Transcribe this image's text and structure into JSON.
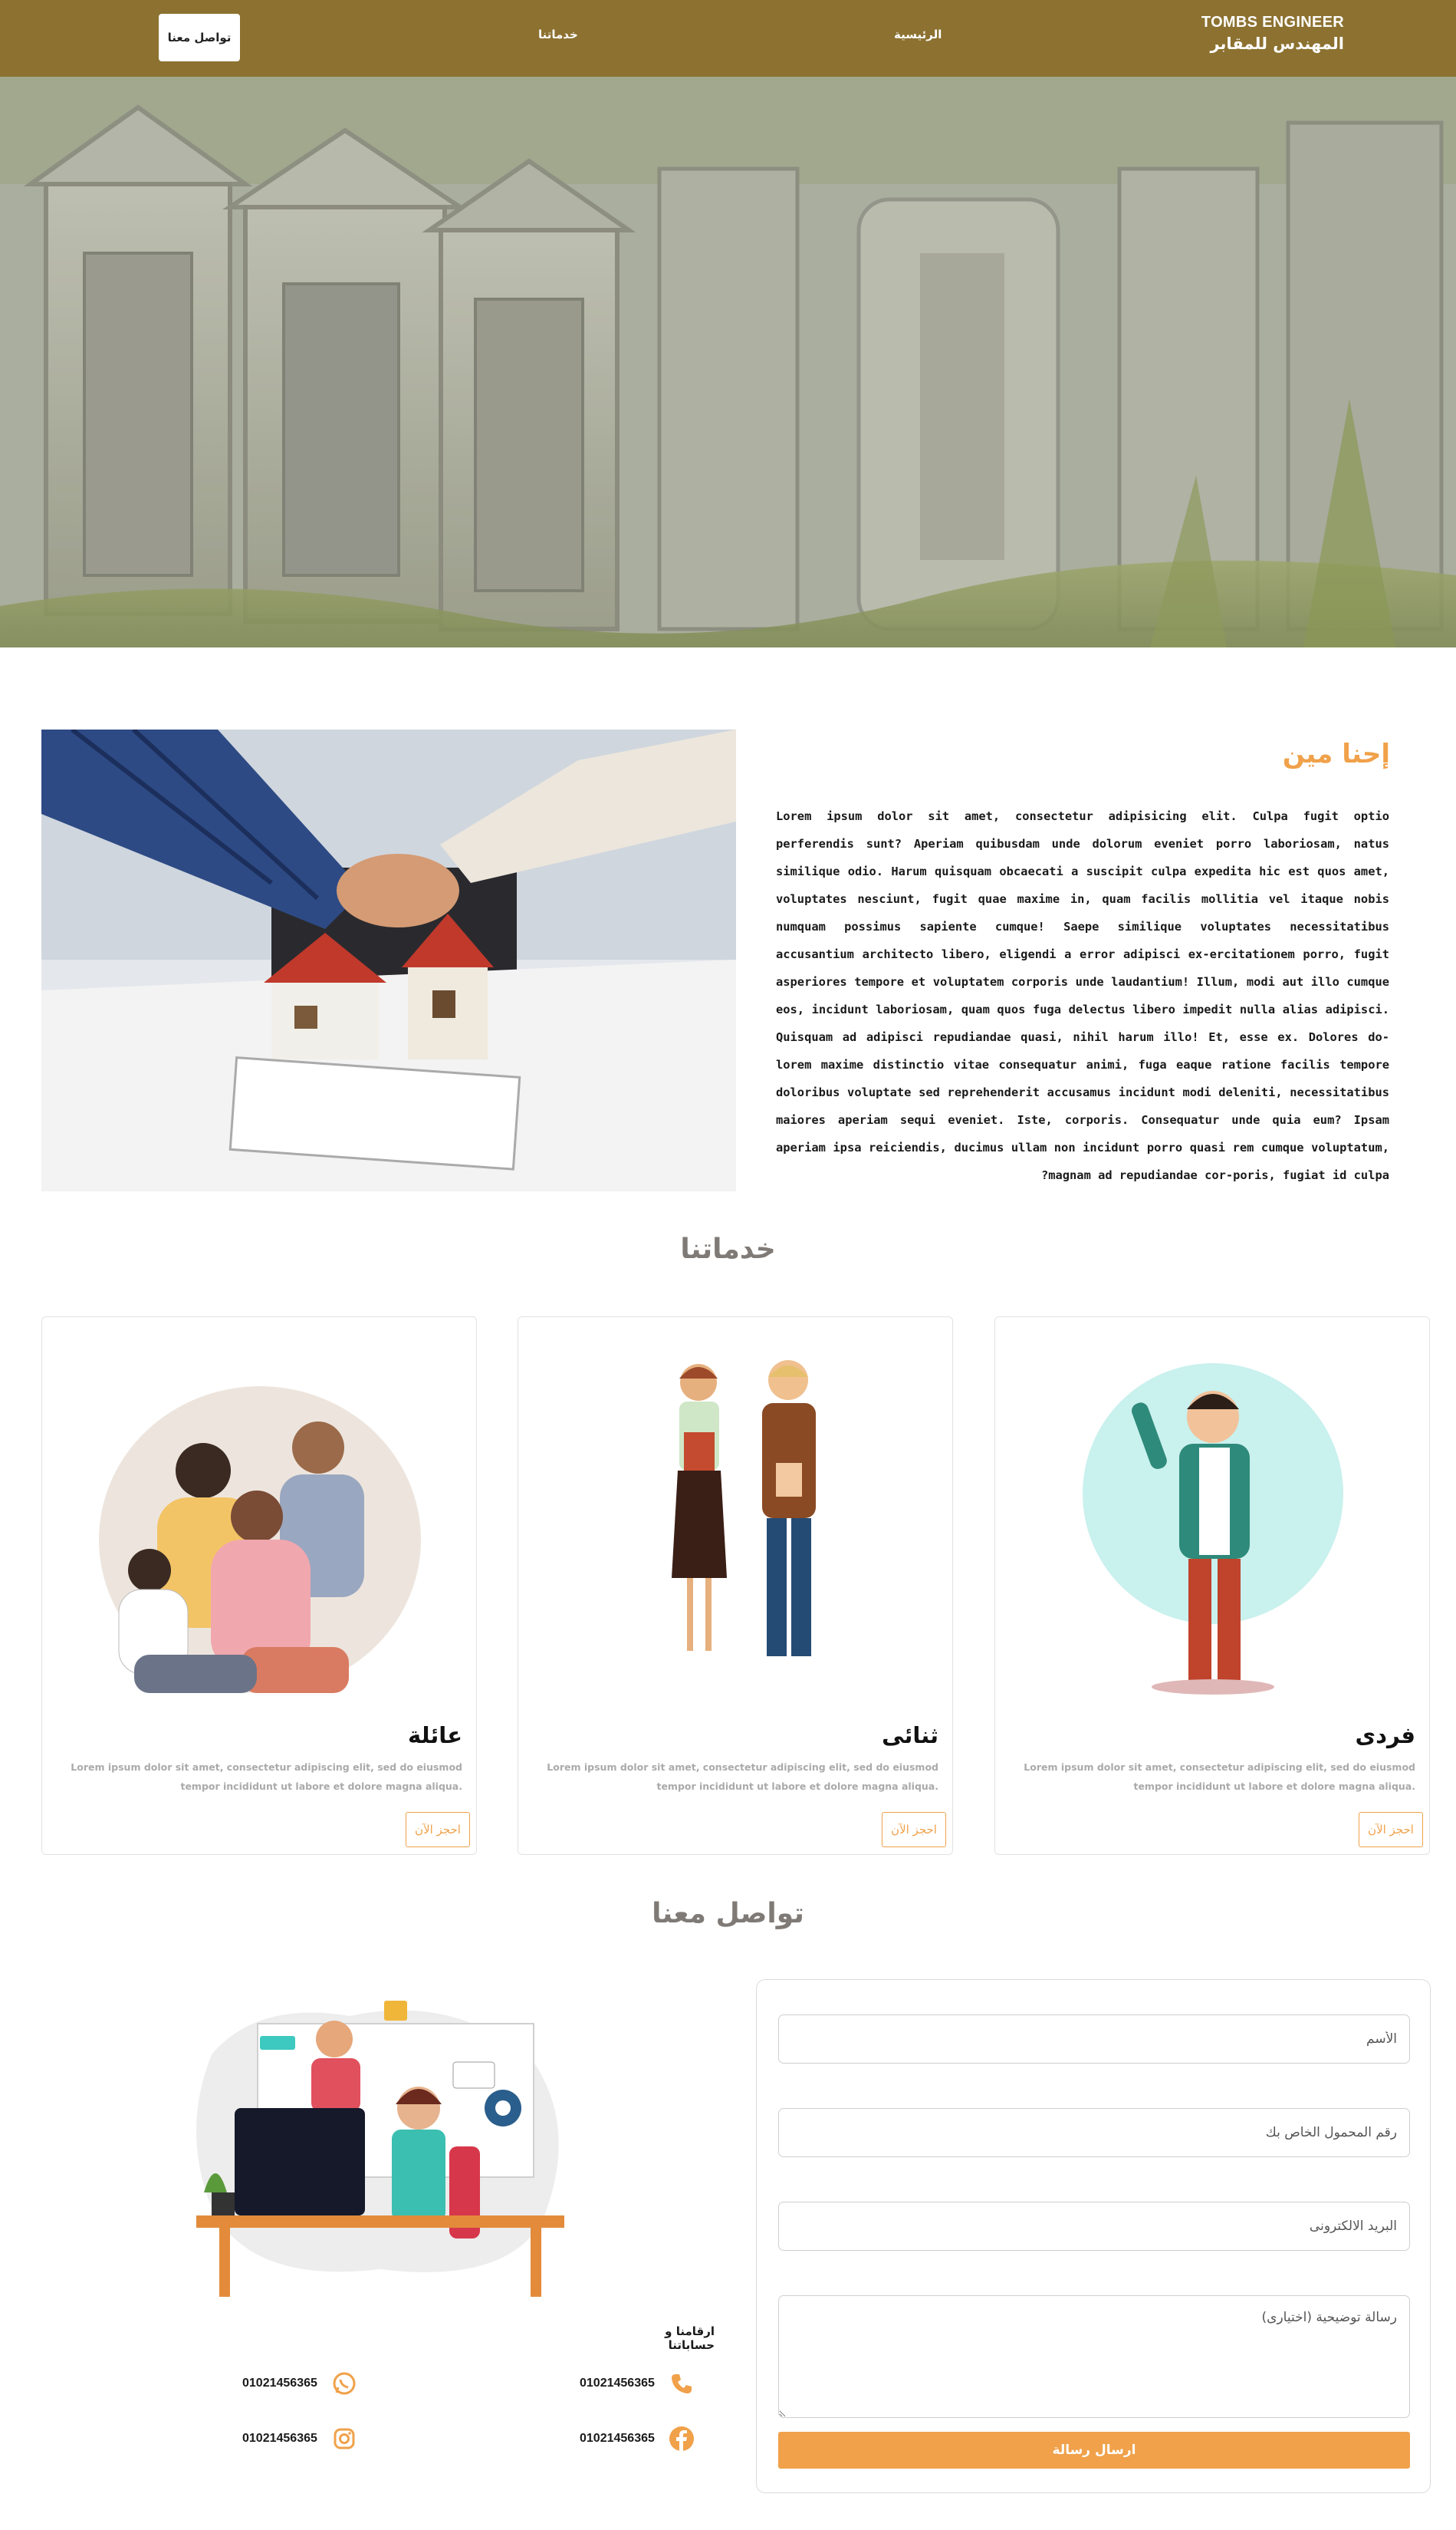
{
  "navbar": {
    "contact_button": "تواصل معنا",
    "services_link": "خدماتنا",
    "home_link": "الرئيسية",
    "brand_en": "TOMBS ENGINEER",
    "brand_ar": "المهندس للمقابر",
    "bg_color": "#8c7130"
  },
  "hero": {
    "slide_count": 4,
    "active_slide": 4
  },
  "about": {
    "title": "إحنا مين",
    "text": "Lorem ipsum dolor sit amet, consectetur adipisicing elit. Culpa fugit optio perferendis sunt? Aperiam quibusdam unde dolorum eveniet porro laboriosam, natus similique odio. Harum quisquam obcaecati a suscipit culpa expedita hic est quos amet, voluptates nesciunt, fugit quae maxime in, quam facilis mollitia vel itaque nobis numquam possimus sapiente cumque! Saepe similique voluptates necessitatibus accusantium architecto libero, eligendi a error adipisci ex-ercitationem porro, fugit asperiores tempore et voluptatem corporis unde laudantium! Illum, modi aut illo cumque eos, incidunt laboriosam, quam quos fuga delectus libero impedit nulla alias adipisci. Quisquam ad adipisci repudiandae quasi, nihil harum illo! Et, esse ex. Dolores do-lorem maxime distinctio vitae consequatur animi, fuga eaque ratione facilis tempore doloribus voluptate sed reprehenderit accusamus incidunt modi deleniti, necessitatibus maiores aperiam sequi eveniet. Iste, corporis. Consequatur unde quia eum? Ipsam aperiam ipsa reiciendis, ducimus ullam non incidunt porro quasi rem cumque voluptatum, magnam ad repudiandae cor-poris, fugiat id culpa?"
  },
  "services": {
    "heading": "خدماتنا",
    "cards": [
      {
        "title": "عائلة",
        "desc": "Lorem ipsum dolor sit amet, consectetur adipiscing elit, sed do eiusmod tempor incididunt ut labore et dolore magna aliqua.",
        "button": "احجز الآن",
        "illustration": "family-illustration"
      },
      {
        "title": "ثنائى",
        "desc": "Lorem ipsum dolor sit amet, consectetur adipiscing elit, sed do eiusmod tempor incididunt ut labore et dolore magna aliqua.",
        "button": "احجز الآن",
        "illustration": "couple-illustration"
      },
      {
        "title": "فردى",
        "desc": "Lorem ipsum dolor sit amet, consectetur adipiscing elit, sed do eiusmod tempor incididunt ut labore et dolore magna aliqua.",
        "button": "احجز الآن",
        "illustration": "single-person-illustration"
      }
    ]
  },
  "contact": {
    "heading": "تواصل معنا",
    "accounts_label": "ارقامنا و حساباتنا",
    "items": [
      {
        "icon": "whatsapp-icon",
        "value": "01021456365"
      },
      {
        "icon": "phone-icon",
        "value": "01021456365"
      },
      {
        "icon": "instagram-icon",
        "value": "01021456365"
      },
      {
        "icon": "facebook-icon",
        "value": "01021456365"
      }
    ],
    "form": {
      "name_placeholder": "الأسم",
      "phone_placeholder": "رقم المحمول الخاص بك",
      "email_placeholder": "البريد الالكترونى",
      "message_placeholder": "رسالة توضيحية (اختيارى)",
      "submit": "ارسال رسالة"
    }
  },
  "colors": {
    "accent": "#f0a14a",
    "heading_gray": "#7f7a76",
    "navbar": "#8c7130"
  }
}
